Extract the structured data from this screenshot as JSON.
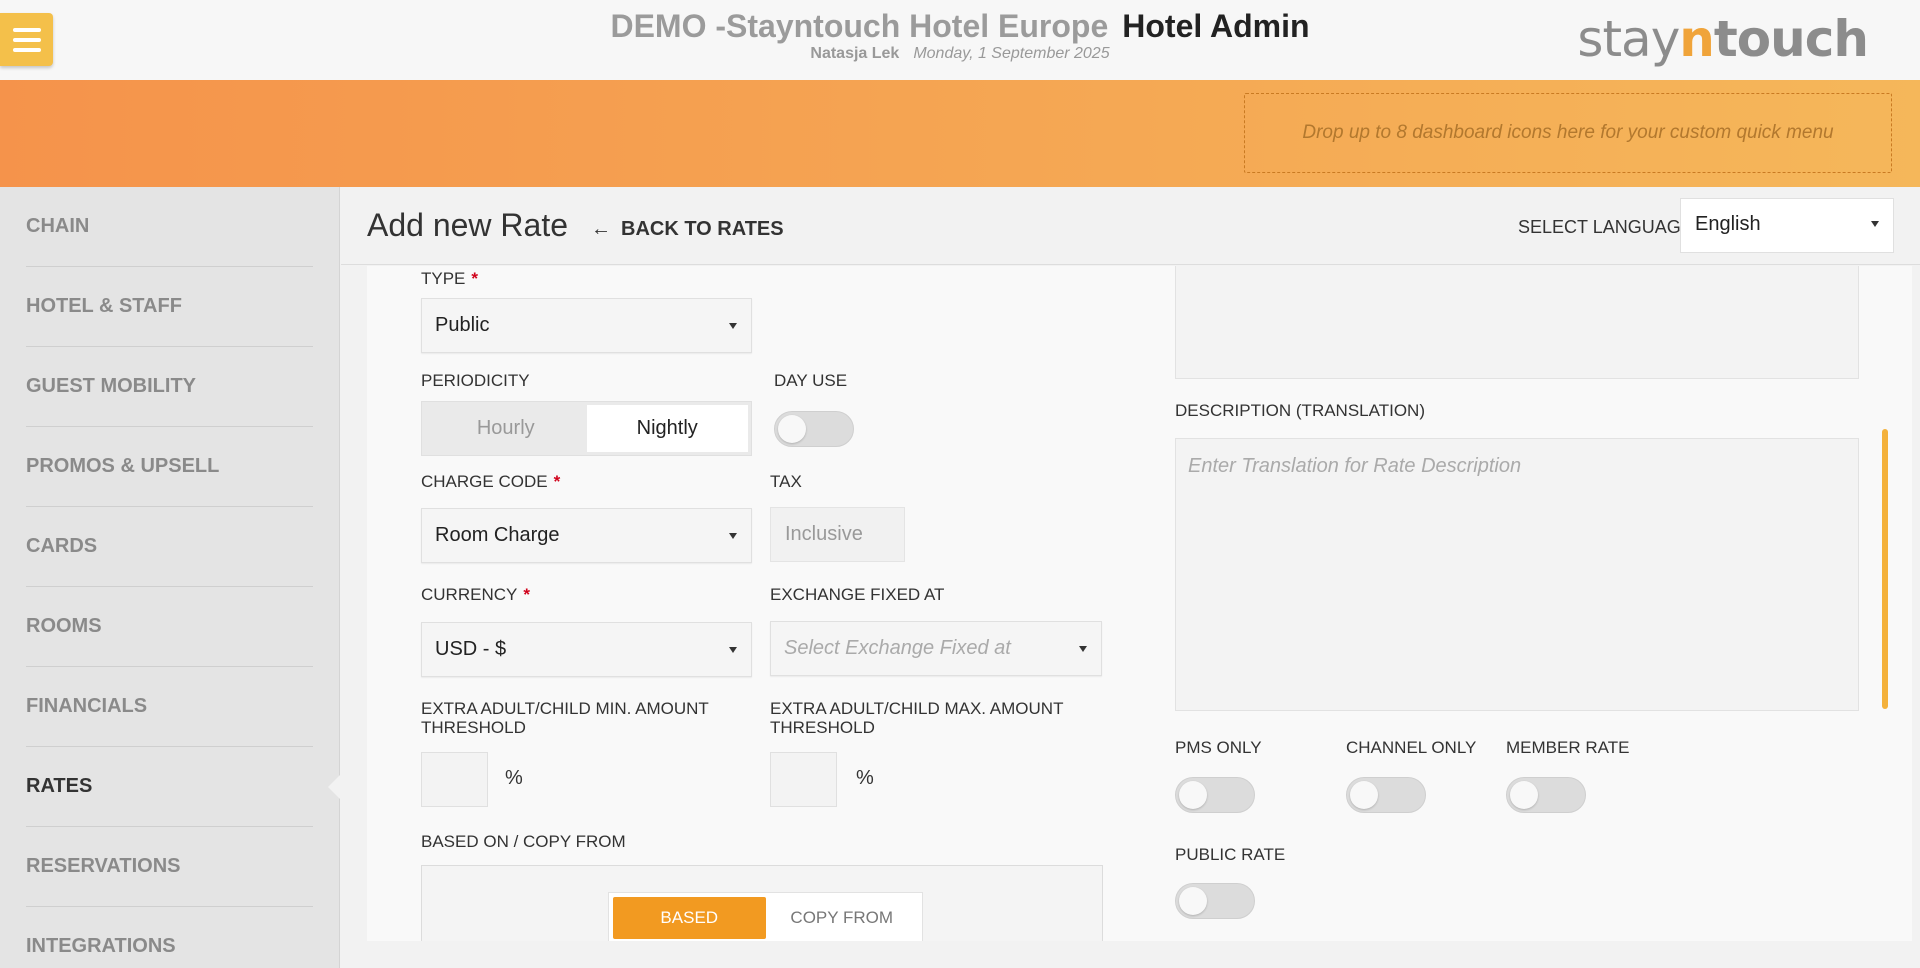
{
  "header": {
    "hotel_name": "DEMO -Stayntouch Hotel Europe",
    "app_name": "Hotel Admin",
    "user_name": "Natasja Lek",
    "date": "Monday, 1 September 2025",
    "logo": {
      "stay": "stay",
      "n": "n",
      "touch": "touch"
    }
  },
  "banner": {
    "dropzone_text": "Drop up to 8 dashboard icons here for your custom quick menu"
  },
  "sidebar": {
    "items": [
      {
        "label": "CHAIN"
      },
      {
        "label": "HOTEL & STAFF"
      },
      {
        "label": "GUEST MOBILITY"
      },
      {
        "label": "PROMOS & UPSELL"
      },
      {
        "label": "CARDS"
      },
      {
        "label": "ROOMS"
      },
      {
        "label": "FINANCIALS"
      },
      {
        "label": "RATES",
        "active": true
      },
      {
        "label": "RESERVATIONS"
      },
      {
        "label": "INTEGRATIONS"
      }
    ]
  },
  "page": {
    "title": "Add new Rate",
    "back_label": "BACK TO RATES",
    "select_language_label": "SELECT LANGUAGE",
    "language_value": "English"
  },
  "form": {
    "type_label": "TYPE",
    "type_value": "Public",
    "periodicity_label": "PERIODICITY",
    "periodicity_options": [
      "Hourly",
      "Nightly"
    ],
    "periodicity_selected": "Nightly",
    "day_use_label": "DAY USE",
    "charge_code_label": "CHARGE CODE",
    "charge_code_value": "Room Charge",
    "tax_label": "TAX",
    "tax_value": "Inclusive",
    "currency_label": "CURRENCY",
    "currency_value": "USD - $",
    "exchange_label": "EXCHANGE FIXED AT",
    "exchange_placeholder": "Select Exchange Fixed at",
    "min_threshold_label_1": "EXTRA ADULT/CHILD MIN. AMOUNT",
    "min_threshold_label_2": "THRESHOLD",
    "max_threshold_label_1": "EXTRA ADULT/CHILD MAX. AMOUNT",
    "max_threshold_label_2": "THRESHOLD",
    "percent": "%",
    "based_on_label": "BASED ON / COPY FROM",
    "based_tab": "BASED",
    "copy_tab": "COPY FROM",
    "description_translation_label": "DESCRIPTION (TRANSLATION)",
    "description_translation_placeholder": "Enter Translation for Rate Description",
    "pms_only_label": "PMS ONLY",
    "channel_only_label": "CHANNEL ONLY",
    "member_rate_label": "MEMBER RATE",
    "public_rate_label": "PUBLIC RATE"
  },
  "colors": {
    "accent": "#f29a21",
    "banner_start": "#f5934b",
    "banner_end": "#f5b75a",
    "required": "#d0021b"
  }
}
